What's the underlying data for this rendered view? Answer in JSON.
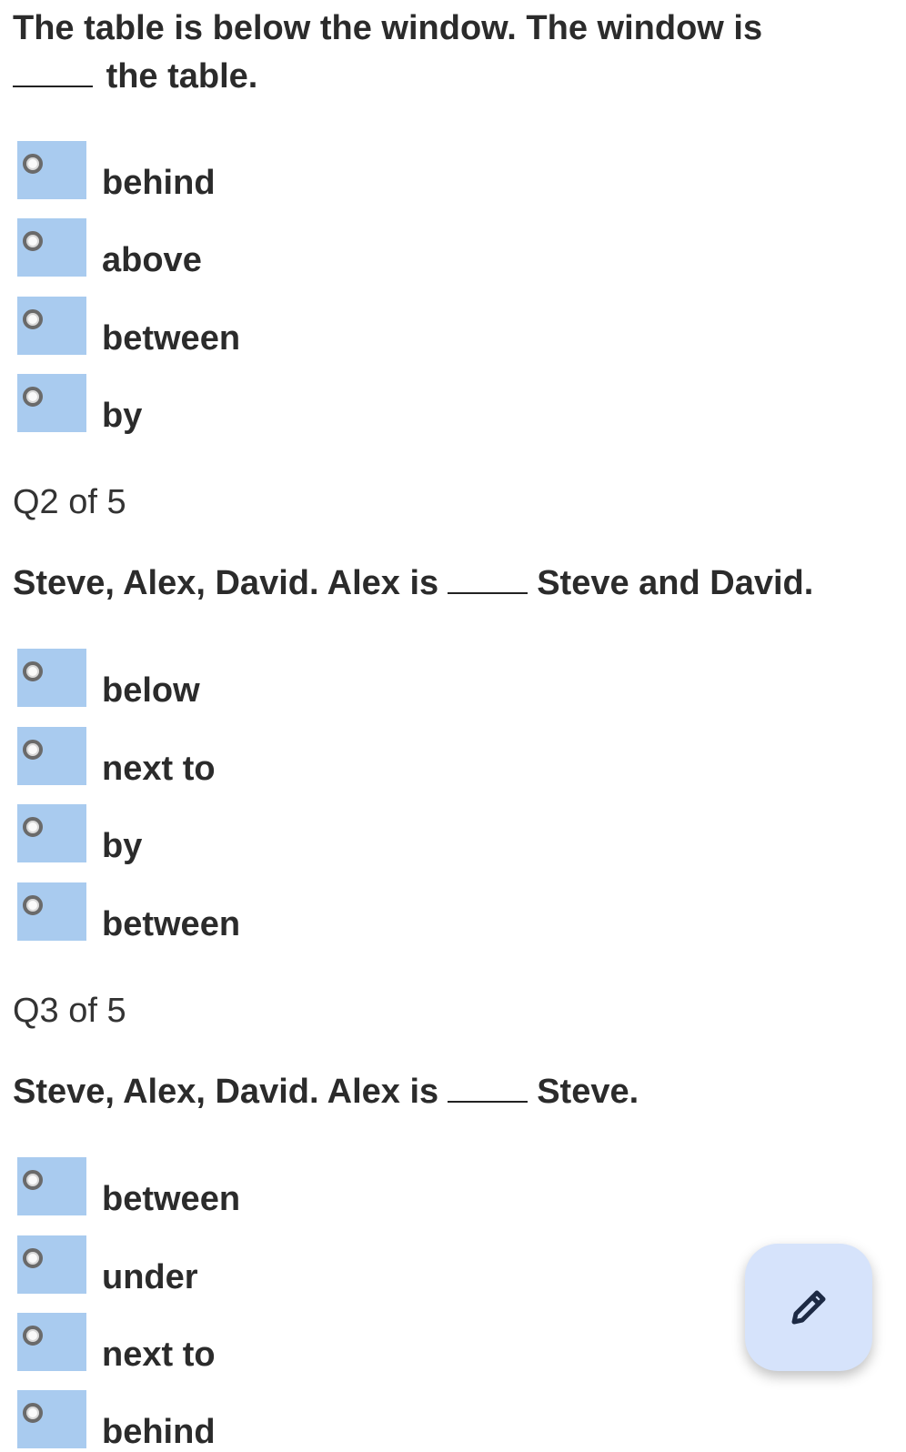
{
  "q1": {
    "text_line1": "The table is below the window. The window is",
    "text_line2": "the table.",
    "options": [
      "behind",
      "above",
      "between",
      "by"
    ]
  },
  "q2": {
    "header": "Q2 of 5",
    "text_before": "Steve, Alex, David. Alex is",
    "text_after": "Steve and David.",
    "options": [
      "below",
      "next to",
      "by",
      "between"
    ]
  },
  "q3": {
    "header": "Q3 of 5",
    "text_before": "Steve, Alex, David. Alex is",
    "text_after": "Steve.",
    "options": [
      "between",
      "under",
      "next to",
      "behind"
    ]
  },
  "fab": {
    "icon": "pencil-icon"
  },
  "colors": {
    "radio_box": "#a9cbef",
    "fab_bg": "#d6e3fb",
    "fab_icon": "#1d2a44"
  }
}
